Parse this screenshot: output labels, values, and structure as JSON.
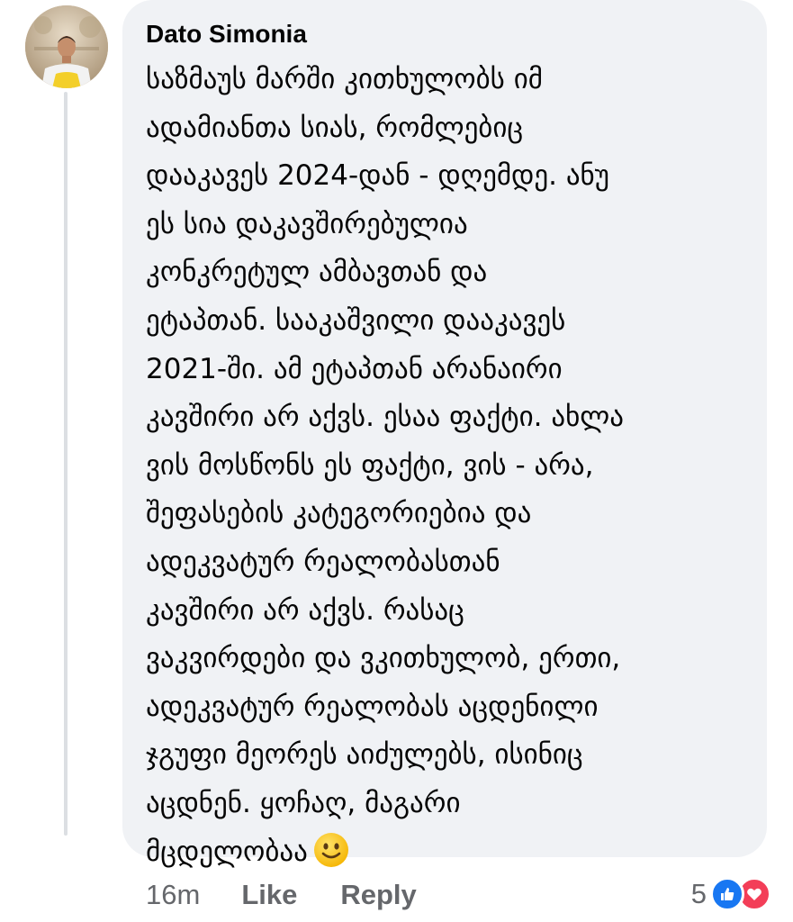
{
  "comment": {
    "author": "Dato Simonia",
    "lines": [
      "საზმაუს მარში კითხულობს იმ",
      "ადამიანთა სიას, რომლებიც",
      "დააკავეს 2024-დან - დღემდე. ანუ",
      "ეს სია დაკავშირებულია",
      "კონკრეტულ ამბავთან და",
      "ეტაპთან. სააკაშვილი დააკავეს",
      "2021-ში. ამ ეტაპთან არანაირი",
      "კავშირი არ აქვს. ესაა ფაქტი. ახლა",
      "ვის მოსწონს ეს ფაქტი, ვის - არა,",
      "შეფასების კატეგორიებია და",
      "ადეკვატურ რეალობასთან",
      "კავშირი არ აქვს. რასაც",
      "ვაკვირდები და ვკითხულობ, ერთი,",
      "ადეკვატურ რეალობას აცდენილი",
      "ჯგუფი მეორეს აიძულებს, ისინიც",
      "აცდნენ. ყოჩაღ, მაგარი",
      "მცდელობაა"
    ],
    "emoji_icon": "slightly-smiling-face-icon"
  },
  "footer": {
    "time": "16m",
    "like_label": "Like",
    "reply_label": "Reply"
  },
  "reactions": {
    "count": "5",
    "icons": [
      "like-reaction-icon",
      "love-reaction-icon"
    ],
    "like_color": "#1877f2",
    "love_color": "#f33e58"
  },
  "colors": {
    "bubble": "#f0f2f5",
    "text": "#050505",
    "meta": "#65676b"
  }
}
